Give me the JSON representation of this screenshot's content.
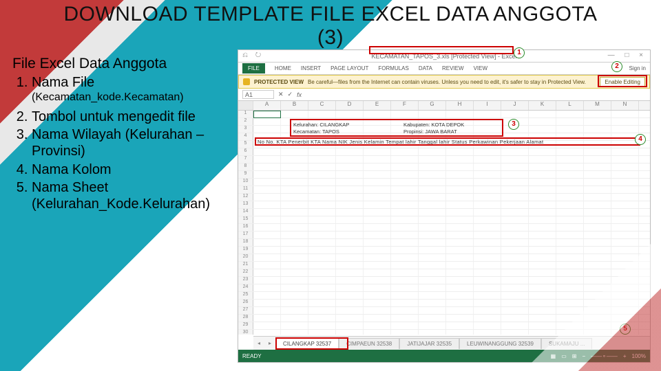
{
  "title_line1": "DOWNLOAD TEMPLATE FILE EXCEL DATA ANGGOTA",
  "title_line2": "(3)",
  "lead": "File Excel Data Anggota",
  "items": [
    {
      "label": "Nama File",
      "note": "(Kecamatan_kode.Kecamatan)"
    },
    {
      "label": "Tombol untuk mengedit file"
    },
    {
      "label": "Nama Wilayah (Kelurahan – Provinsi)"
    },
    {
      "label": "Nama Kolom"
    },
    {
      "label": "Nama Sheet (Kelurahan_Kode.Kelurahan)"
    }
  ],
  "excel": {
    "filename": "KECAMATAN_TAPOS_3.xls  [Protected View] - Excel",
    "qat": "⎌ ↻",
    "winbtns": "— □ ×",
    "tabs": {
      "file": "FILE",
      "home": "HOME",
      "insert": "INSERT",
      "pagelayout": "PAGE LAYOUT",
      "formulas": "FORMULAS",
      "data": "DATA",
      "review": "REVIEW",
      "view": "VIEW"
    },
    "signin": "Sign in",
    "pv_label": "PROTECTED VIEW",
    "pv_msg": "Be careful—files from the Internet can contain viruses. Unless you need to edit, it's safer to stay in Protected View.",
    "pv_btn": "Enable Editing",
    "namebox": "A1",
    "fx": "fx",
    "cols": [
      "",
      "A",
      "B",
      "C",
      "D",
      "E",
      "F",
      "G",
      "H",
      "I",
      "J",
      "K",
      "L",
      "M",
      "N"
    ],
    "row_count": 31,
    "region": {
      "kelurahan_l": "Kelurahan:",
      "kelurahan_v": "CILANGKAP",
      "kecamatan_l": "Kecamatan:",
      "kecamatan_v": "TAPOS",
      "kabupaten_l": "Kabupaten:",
      "kabupaten_v": "KOTA DEPOK",
      "propinsi_l": "Propinsi:",
      "propinsi_v": "JAWA BARAT"
    },
    "col_headers": "No   No. KTA   Penerbit KTA  Nama   NIK   Jenis Kelamin  Tempat lahir  Tanggal lahir  Status Perkawinan  Pekerjaan  Alamat",
    "sheets": [
      "CILANGKAP 32537",
      "CIMPAEUN 32538",
      "JATIJAJAR 32535",
      "LEUWINANGGUNG 32539",
      "SUKAMAJU ..."
    ],
    "status_ready": "READY",
    "zoom": "100%"
  },
  "callouts": {
    "1": "1",
    "2": "2",
    "3": "3",
    "4": "4",
    "5": "5"
  }
}
